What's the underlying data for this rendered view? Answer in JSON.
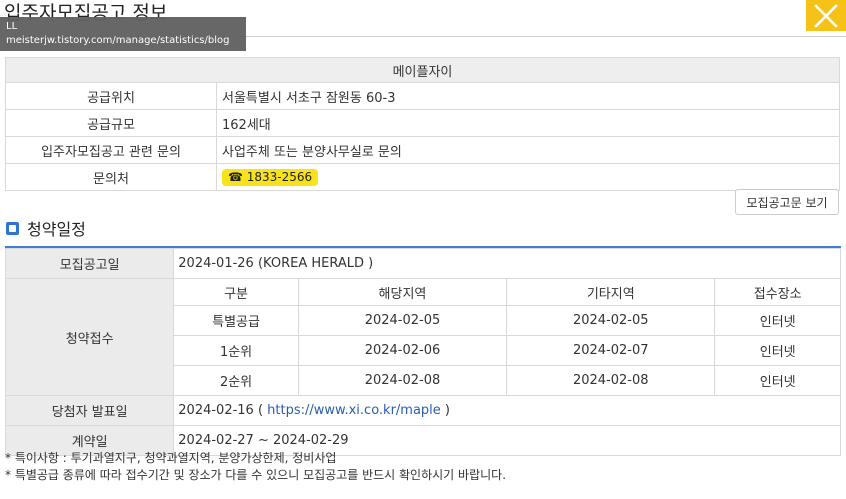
{
  "page": {
    "title": "입주자모집공고 정보",
    "tooltip_line1": "LL",
    "tooltip_line2": "meisterjw.tistory.com/manage/statistics/blog",
    "close_label": "close"
  },
  "complex": {
    "name": "메이플자이",
    "rows": [
      {
        "label": "공급위치",
        "value": "서울특별시 서초구 잠원동 60-3"
      },
      {
        "label": "공급규모",
        "value": "162세대"
      },
      {
        "label": "입주자모집공고 관련 문의",
        "value": "사업주체 또는 분양사무실로 문의"
      }
    ],
    "contact_label": "문의처",
    "contact_phone": "☎ 1833-2566"
  },
  "notice_button": "모집공고문 보기",
  "schedule": {
    "section_title": "청약일정",
    "announce_label": "모집공고일",
    "announce_value": "2024-01-26 (KOREA HERALD )",
    "apply_label": "청약접수",
    "columns": [
      "구분",
      "해당지역",
      "기타지역",
      "접수장소"
    ],
    "rows": [
      [
        "특별공급",
        "2024-02-05",
        "2024-02-05",
        "인터넷"
      ],
      [
        "1순위",
        "2024-02-06",
        "2024-02-07",
        "인터넷"
      ],
      [
        "2순위",
        "2024-02-08",
        "2024-02-08",
        "인터넷"
      ]
    ],
    "winner_label": "당첨자 발표일",
    "winner_date": "2024-02-16 ( ",
    "winner_link": "https://www.xi.co.kr/maple",
    "winner_suffix": " )",
    "contract_label": "계약일",
    "contract_value": "2024-02-27 ~ 2024-02-29"
  },
  "notes": [
    "* 특이사항 : 투기과열지구, 청약과열지역, 분양가상한제, 정비사업",
    "* 특별공급 종류에 따라 접수기간 및 장소가 다를 수 있으니 모집공고를 반드시 확인하시기 바랍니다."
  ],
  "colors": {
    "accent_blue": "#3f7fd6",
    "close_yellow": "#f6c218",
    "phone_yellow": "#f7e21b"
  }
}
